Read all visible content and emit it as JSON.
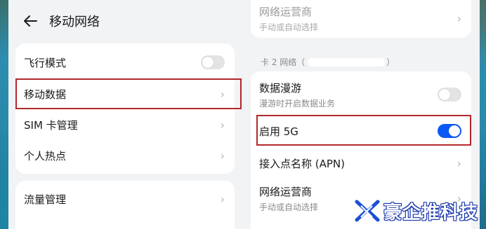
{
  "left": {
    "title": "移动网络",
    "items": [
      {
        "label": "飞行模式",
        "toggle": false
      },
      {
        "label": "移动数据"
      },
      {
        "label": "SIM 卡管理"
      },
      {
        "label": "个人热点"
      }
    ],
    "items2": [
      {
        "label": "流量管理"
      }
    ]
  },
  "right": {
    "top_item": {
      "label": "网络运营商",
      "sub": "手动或自动选择"
    },
    "section_label": "卡 2 网络（",
    "section_label_end": "）",
    "items": [
      {
        "label": "数据漫游",
        "sub": "漫游时开启数据业务",
        "toggle": false
      },
      {
        "label": "启用 5G",
        "toggle": true
      },
      {
        "label": "接入点名称 (APN)"
      },
      {
        "label": "网络运营商",
        "sub": "手动或自动选择"
      }
    ]
  },
  "icons": {
    "chevron": "chevron-right-icon",
    "back": "back-arrow-icon"
  },
  "colors": {
    "accent": "#0a59f7",
    "highlight_box": "#b3282d",
    "background": "#f1f3f5"
  },
  "watermark": {
    "text": "豪企推科技"
  }
}
